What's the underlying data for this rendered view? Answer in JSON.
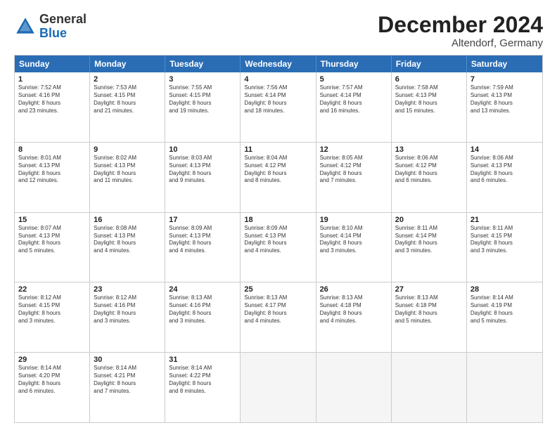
{
  "header": {
    "logo_general": "General",
    "logo_blue": "Blue",
    "month_title": "December 2024",
    "subtitle": "Altendorf, Germany"
  },
  "days_of_week": [
    "Sunday",
    "Monday",
    "Tuesday",
    "Wednesday",
    "Thursday",
    "Friday",
    "Saturday"
  ],
  "rows": [
    [
      {
        "day": "1",
        "lines": [
          "Sunrise: 7:52 AM",
          "Sunset: 4:16 PM",
          "Daylight: 8 hours",
          "and 23 minutes."
        ]
      },
      {
        "day": "2",
        "lines": [
          "Sunrise: 7:53 AM",
          "Sunset: 4:15 PM",
          "Daylight: 8 hours",
          "and 21 minutes."
        ]
      },
      {
        "day": "3",
        "lines": [
          "Sunrise: 7:55 AM",
          "Sunset: 4:15 PM",
          "Daylight: 8 hours",
          "and 19 minutes."
        ]
      },
      {
        "day": "4",
        "lines": [
          "Sunrise: 7:56 AM",
          "Sunset: 4:14 PM",
          "Daylight: 8 hours",
          "and 18 minutes."
        ]
      },
      {
        "day": "5",
        "lines": [
          "Sunrise: 7:57 AM",
          "Sunset: 4:14 PM",
          "Daylight: 8 hours",
          "and 16 minutes."
        ]
      },
      {
        "day": "6",
        "lines": [
          "Sunrise: 7:58 AM",
          "Sunset: 4:13 PM",
          "Daylight: 8 hours",
          "and 15 minutes."
        ]
      },
      {
        "day": "7",
        "lines": [
          "Sunrise: 7:59 AM",
          "Sunset: 4:13 PM",
          "Daylight: 8 hours",
          "and 13 minutes."
        ]
      }
    ],
    [
      {
        "day": "8",
        "lines": [
          "Sunrise: 8:01 AM",
          "Sunset: 4:13 PM",
          "Daylight: 8 hours",
          "and 12 minutes."
        ]
      },
      {
        "day": "9",
        "lines": [
          "Sunrise: 8:02 AM",
          "Sunset: 4:13 PM",
          "Daylight: 8 hours",
          "and 11 minutes."
        ]
      },
      {
        "day": "10",
        "lines": [
          "Sunrise: 8:03 AM",
          "Sunset: 4:13 PM",
          "Daylight: 8 hours",
          "and 9 minutes."
        ]
      },
      {
        "day": "11",
        "lines": [
          "Sunrise: 8:04 AM",
          "Sunset: 4:12 PM",
          "Daylight: 8 hours",
          "and 8 minutes."
        ]
      },
      {
        "day": "12",
        "lines": [
          "Sunrise: 8:05 AM",
          "Sunset: 4:12 PM",
          "Daylight: 8 hours",
          "and 7 minutes."
        ]
      },
      {
        "day": "13",
        "lines": [
          "Sunrise: 8:06 AM",
          "Sunset: 4:12 PM",
          "Daylight: 8 hours",
          "and 6 minutes."
        ]
      },
      {
        "day": "14",
        "lines": [
          "Sunrise: 8:06 AM",
          "Sunset: 4:13 PM",
          "Daylight: 8 hours",
          "and 6 minutes."
        ]
      }
    ],
    [
      {
        "day": "15",
        "lines": [
          "Sunrise: 8:07 AM",
          "Sunset: 4:13 PM",
          "Daylight: 8 hours",
          "and 5 minutes."
        ]
      },
      {
        "day": "16",
        "lines": [
          "Sunrise: 8:08 AM",
          "Sunset: 4:13 PM",
          "Daylight: 8 hours",
          "and 4 minutes."
        ]
      },
      {
        "day": "17",
        "lines": [
          "Sunrise: 8:09 AM",
          "Sunset: 4:13 PM",
          "Daylight: 8 hours",
          "and 4 minutes."
        ]
      },
      {
        "day": "18",
        "lines": [
          "Sunrise: 8:09 AM",
          "Sunset: 4:13 PM",
          "Daylight: 8 hours",
          "and 4 minutes."
        ]
      },
      {
        "day": "19",
        "lines": [
          "Sunrise: 8:10 AM",
          "Sunset: 4:14 PM",
          "Daylight: 8 hours",
          "and 3 minutes."
        ]
      },
      {
        "day": "20",
        "lines": [
          "Sunrise: 8:11 AM",
          "Sunset: 4:14 PM",
          "Daylight: 8 hours",
          "and 3 minutes."
        ]
      },
      {
        "day": "21",
        "lines": [
          "Sunrise: 8:11 AM",
          "Sunset: 4:15 PM",
          "Daylight: 8 hours",
          "and 3 minutes."
        ]
      }
    ],
    [
      {
        "day": "22",
        "lines": [
          "Sunrise: 8:12 AM",
          "Sunset: 4:15 PM",
          "Daylight: 8 hours",
          "and 3 minutes."
        ]
      },
      {
        "day": "23",
        "lines": [
          "Sunrise: 8:12 AM",
          "Sunset: 4:16 PM",
          "Daylight: 8 hours",
          "and 3 minutes."
        ]
      },
      {
        "day": "24",
        "lines": [
          "Sunrise: 8:13 AM",
          "Sunset: 4:16 PM",
          "Daylight: 8 hours",
          "and 3 minutes."
        ]
      },
      {
        "day": "25",
        "lines": [
          "Sunrise: 8:13 AM",
          "Sunset: 4:17 PM",
          "Daylight: 8 hours",
          "and 4 minutes."
        ]
      },
      {
        "day": "26",
        "lines": [
          "Sunrise: 8:13 AM",
          "Sunset: 4:18 PM",
          "Daylight: 8 hours",
          "and 4 minutes."
        ]
      },
      {
        "day": "27",
        "lines": [
          "Sunrise: 8:13 AM",
          "Sunset: 4:18 PM",
          "Daylight: 8 hours",
          "and 5 minutes."
        ]
      },
      {
        "day": "28",
        "lines": [
          "Sunrise: 8:14 AM",
          "Sunset: 4:19 PM",
          "Daylight: 8 hours",
          "and 5 minutes."
        ]
      }
    ],
    [
      {
        "day": "29",
        "lines": [
          "Sunrise: 8:14 AM",
          "Sunset: 4:20 PM",
          "Daylight: 8 hours",
          "and 6 minutes."
        ]
      },
      {
        "day": "30",
        "lines": [
          "Sunrise: 8:14 AM",
          "Sunset: 4:21 PM",
          "Daylight: 8 hours",
          "and 7 minutes."
        ]
      },
      {
        "day": "31",
        "lines": [
          "Sunrise: 8:14 AM",
          "Sunset: 4:22 PM",
          "Daylight: 8 hours",
          "and 8 minutes."
        ]
      },
      {
        "day": "",
        "lines": []
      },
      {
        "day": "",
        "lines": []
      },
      {
        "day": "",
        "lines": []
      },
      {
        "day": "",
        "lines": []
      }
    ]
  ]
}
